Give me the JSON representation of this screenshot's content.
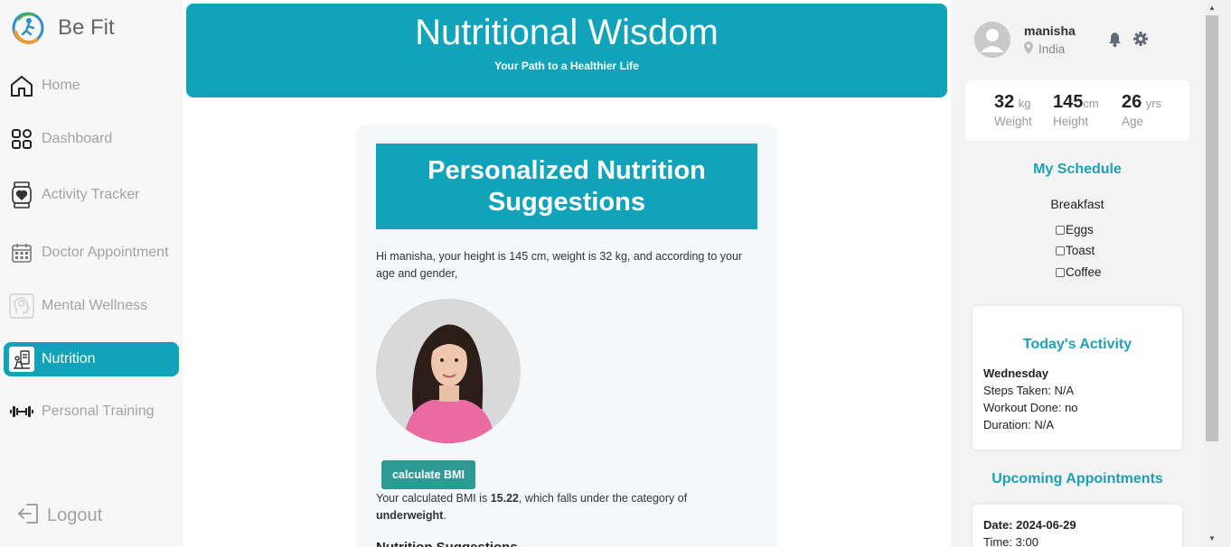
{
  "app": {
    "brand_name": "Be Fit"
  },
  "sidebar": {
    "items": [
      {
        "label": "Home",
        "icon": "home-icon"
      },
      {
        "label": "Dashboard",
        "icon": "dashboard-grid-icon"
      },
      {
        "label": "Activity Tracker",
        "icon": "smartwatch-heart-icon"
      },
      {
        "label": "Doctor Appointment",
        "icon": "calendar-icon"
      },
      {
        "label": "Mental Wellness",
        "icon": "head-brain-icon"
      },
      {
        "label": "Nutrition",
        "icon": "nutrition-icon",
        "active": true
      },
      {
        "label": "Personal Training",
        "icon": "dumbbell-icon"
      }
    ],
    "logout_label": "Logout"
  },
  "header": {
    "title": "Nutritional Wisdom",
    "subtitle": "Your Path to a Healthier Life"
  },
  "main": {
    "banner_title": "Personalized Nutrition Suggestions",
    "intro_text": "Hi manisha, your height is 145 cm, weight is 32 kg, and according to your age and gender,",
    "bmi_button_label": "calculate BMI",
    "bmi_prefix": "Your calculated BMI is ",
    "bmi_value": "15.22",
    "bmi_middle": ", which falls under the category of ",
    "bmi_category": "underweight",
    "bmi_suffix": ".",
    "next_section_title": "Nutrition Suggestions"
  },
  "profile": {
    "name": "manisha",
    "location": "India"
  },
  "stats": [
    {
      "value": "32",
      "unit": "kg",
      "label": "Weight"
    },
    {
      "value": "145",
      "unit": "cm",
      "label": "Height"
    },
    {
      "value": "26",
      "unit": "yrs",
      "label": "Age"
    }
  ],
  "schedule": {
    "title": "My Schedule",
    "meal": "Breakfast",
    "items": [
      "Eggs",
      "Toast",
      "Coffee"
    ]
  },
  "activity": {
    "title": "Today's Activity",
    "day": "Wednesday",
    "steps": "Steps Taken: N/A",
    "workout": "Workout Done: no",
    "duration": "Duration: N/A"
  },
  "appointments": {
    "title": "Upcoming Appointments",
    "date": "Date: 2024-06-29",
    "time": "Time: 3:00"
  },
  "colors": {
    "accent": "#11a3ba",
    "heading": "#1ea0b6",
    "button": "#2e9a94"
  }
}
